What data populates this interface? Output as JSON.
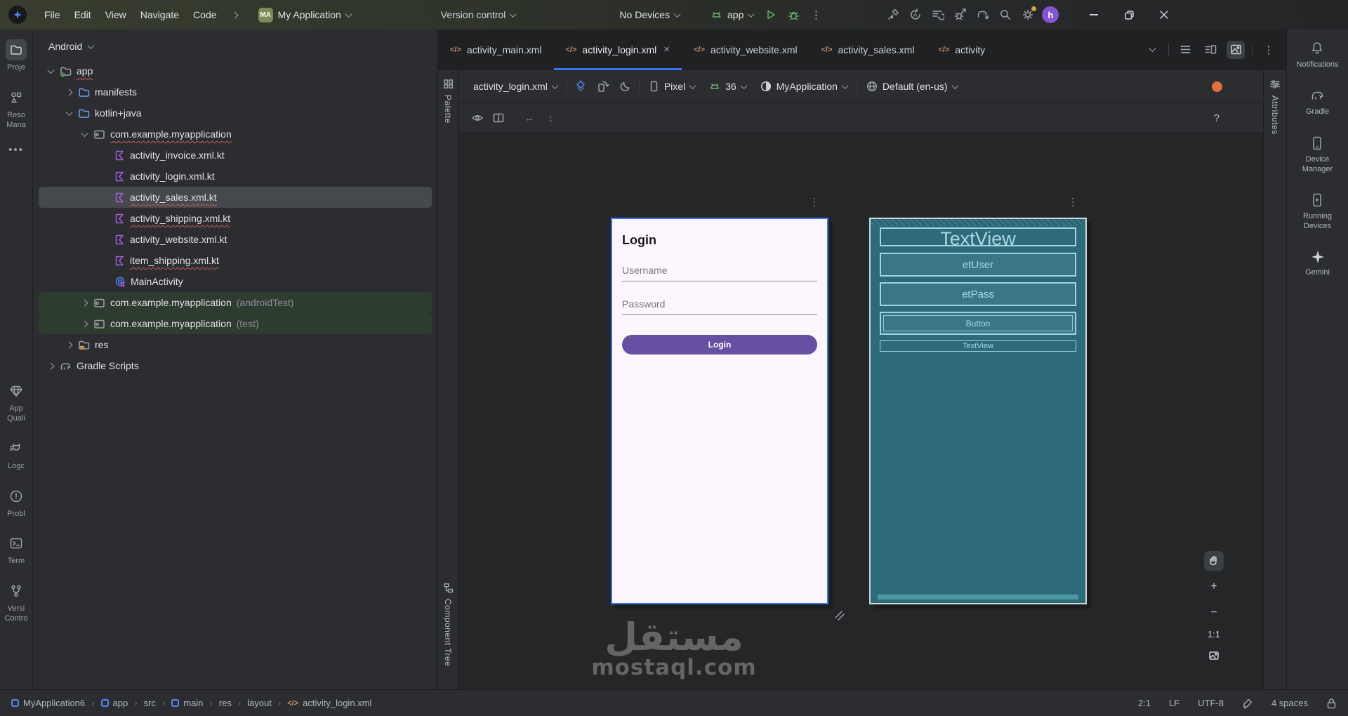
{
  "colors": {
    "accent_blue": "#3574f0",
    "run_green": "#5fad65",
    "kotlin_purple": "#a85ce0",
    "xml_orange": "#cf8e6d",
    "error_orange": "#e2703d",
    "login_purple": "#6650a4",
    "blueprint_teal": "#2d6b79",
    "blueprint_line": "#9fd4e5",
    "selection_green": "#2e3c2f"
  },
  "icons": {
    "kebab": "⋮",
    "dots": "⋮",
    "close": "×",
    "plus": "+",
    "minus": "−",
    "crumb": "›",
    "arrow_lr": "↔",
    "arrow_ud": "↕",
    "more": "•••"
  },
  "topbar": {
    "menu": [
      "File",
      "Edit",
      "View",
      "Navigate",
      "Code"
    ],
    "project_badge": "MA",
    "project_name": "My Application",
    "version_control": "Version control",
    "devices": "No Devices",
    "run_config": "app",
    "avatar_letter": "h"
  },
  "stripe_left": {
    "project": "Proje",
    "resource_manager": "Reso\nMana",
    "app_quality": "App\nQuali",
    "logcat": "Logc",
    "problems": "Probl",
    "terminal": "Term",
    "version_control": "Versi\nContro"
  },
  "project": {
    "view": "Android",
    "tree": [
      {
        "label": "app"
      },
      {
        "label": "manifests"
      },
      {
        "label": "kotlin+java"
      },
      {
        "label": "com.example.myapplication"
      },
      {
        "label": "activity_invoice.xml.kt"
      },
      {
        "label": "activity_login.xml.kt"
      },
      {
        "label": "activity_sales.xml.kt"
      },
      {
        "label": "activity_shipping.xml.kt"
      },
      {
        "label": "activity_website.xml.kt"
      },
      {
        "label": "item_shipping.xml.kt"
      },
      {
        "label": "MainActivity"
      },
      {
        "label": "com.example.myapplication",
        "suffix": "(androidTest)"
      },
      {
        "label": "com.example.myapplication",
        "suffix": "(test)"
      },
      {
        "label": "res"
      },
      {
        "label": "Gradle Scripts"
      }
    ]
  },
  "tabs": [
    {
      "label": "activity_main.xml"
    },
    {
      "label": "activity_login.xml"
    },
    {
      "label": "activity_website.xml"
    },
    {
      "label": "activity_sales.xml"
    },
    {
      "label": "activity"
    }
  ],
  "design_toolbar": {
    "file": "activity_login.xml",
    "device": "Pixel",
    "api": "36",
    "theme": "MyApplication",
    "locale": "Default (en-us)",
    "help": "?"
  },
  "panels": {
    "palette": "Palette",
    "component_tree": "Component Tree",
    "attributes": "Attributes"
  },
  "canvas": {
    "login_preview": {
      "title": "Login",
      "username_placeholder": "Username",
      "password_placeholder": "Password",
      "button": "Login"
    },
    "blueprint": {
      "textview_large": "TextView",
      "et_user": "etUser",
      "et_pass": "etPass",
      "button": "Button",
      "textview_small": "TextView"
    },
    "zoom_ratio": "1:1"
  },
  "sidebar_right": {
    "notifications": "Notifications",
    "gradle": "Gradle",
    "device_manager": "Device\nManager",
    "running_devices": "Running\nDevices",
    "gemini": "Gemini"
  },
  "statusbar": {
    "breadcrumbs": [
      "MyApplication6",
      "app",
      "src",
      "main",
      "res",
      "layout",
      "activity_login.xml"
    ],
    "line_col": "2:1",
    "line_sep": "LF",
    "encoding": "UTF-8",
    "indent": "4 spaces"
  },
  "watermark": {
    "arabic": "مستقل",
    "domain": "mostaql.com"
  }
}
